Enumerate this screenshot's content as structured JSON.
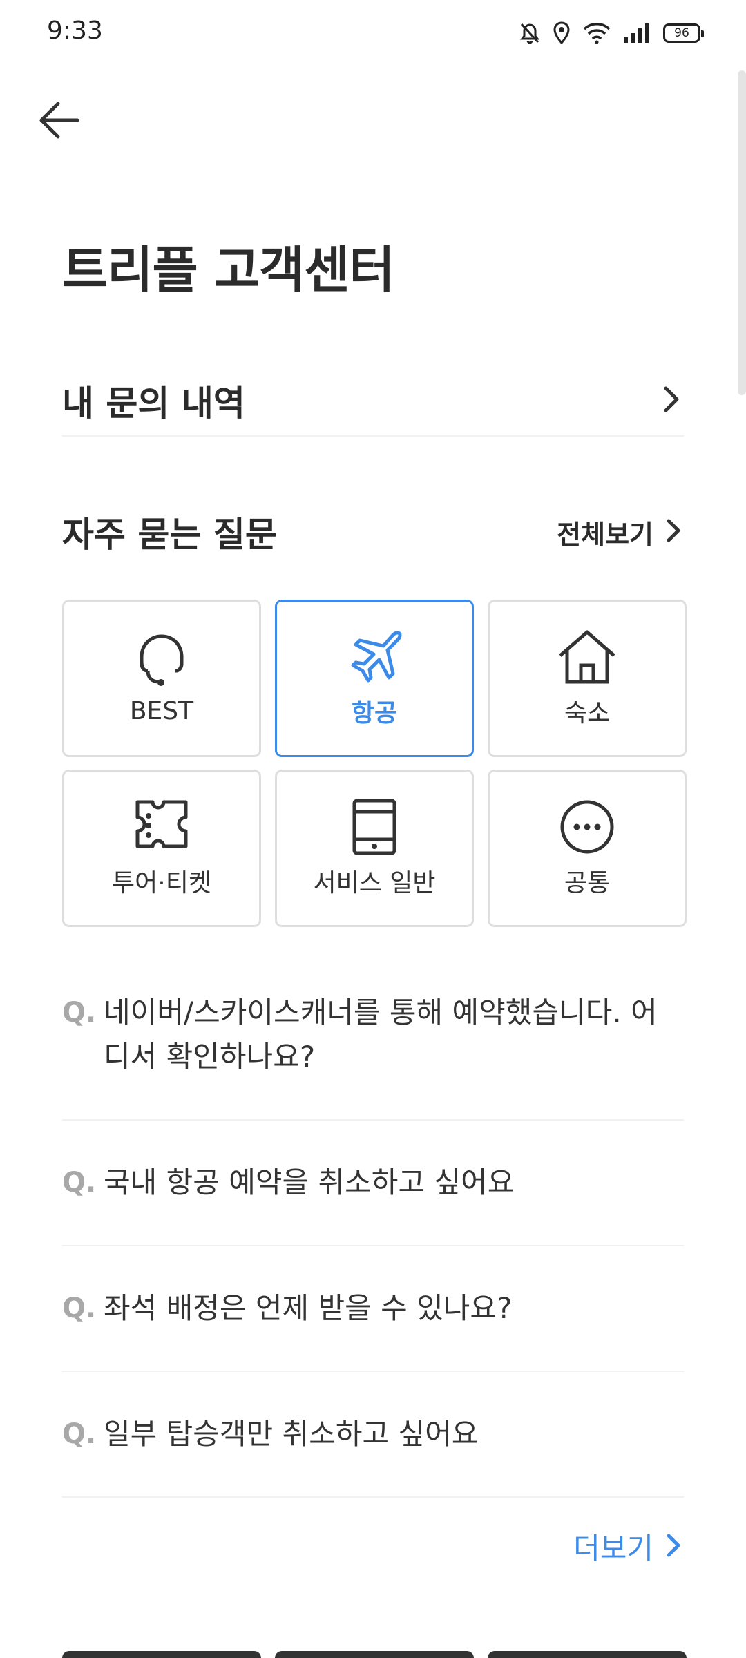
{
  "status_bar": {
    "time": "9:33",
    "battery": "96",
    "icons": [
      "bell-off-icon",
      "location-icon",
      "wifi-icon",
      "signal-icon",
      "battery-icon"
    ]
  },
  "header": {
    "back_icon": "arrow-left-icon",
    "title": "트리플 고객센터"
  },
  "my_inquiries": {
    "label": "내 문의 내역",
    "icon": "chevron-right-icon"
  },
  "faq": {
    "title": "자주 묻는 질문",
    "see_all": "전체보기",
    "categories": [
      {
        "label": "BEST",
        "icon": "headset-icon",
        "selected": false
      },
      {
        "label": "항공",
        "icon": "airplane-icon",
        "selected": true
      },
      {
        "label": "숙소",
        "icon": "house-icon",
        "selected": false
      },
      {
        "label": "투어·티켓",
        "icon": "ticket-icon",
        "selected": false
      },
      {
        "label": "서비스 일반",
        "icon": "tablet-icon",
        "selected": false
      },
      {
        "label": "공통",
        "icon": "more-icon",
        "selected": false
      }
    ],
    "q_prefix": "Q.",
    "questions": [
      "네이버/스카이스캐너를 통해 예약했습니다. 어디서 확인하나요?",
      "국내 항공 예약을 취소하고 싶어요",
      "좌석 배정은 언제 받을 수 있나요?",
      "일부 탑승객만 취소하고 싶어요"
    ],
    "more": "더보기"
  },
  "colors": {
    "accent": "#3d8be8",
    "text": "#2b2b2b",
    "border": "#dedede",
    "muted": "#a8a8a8"
  }
}
